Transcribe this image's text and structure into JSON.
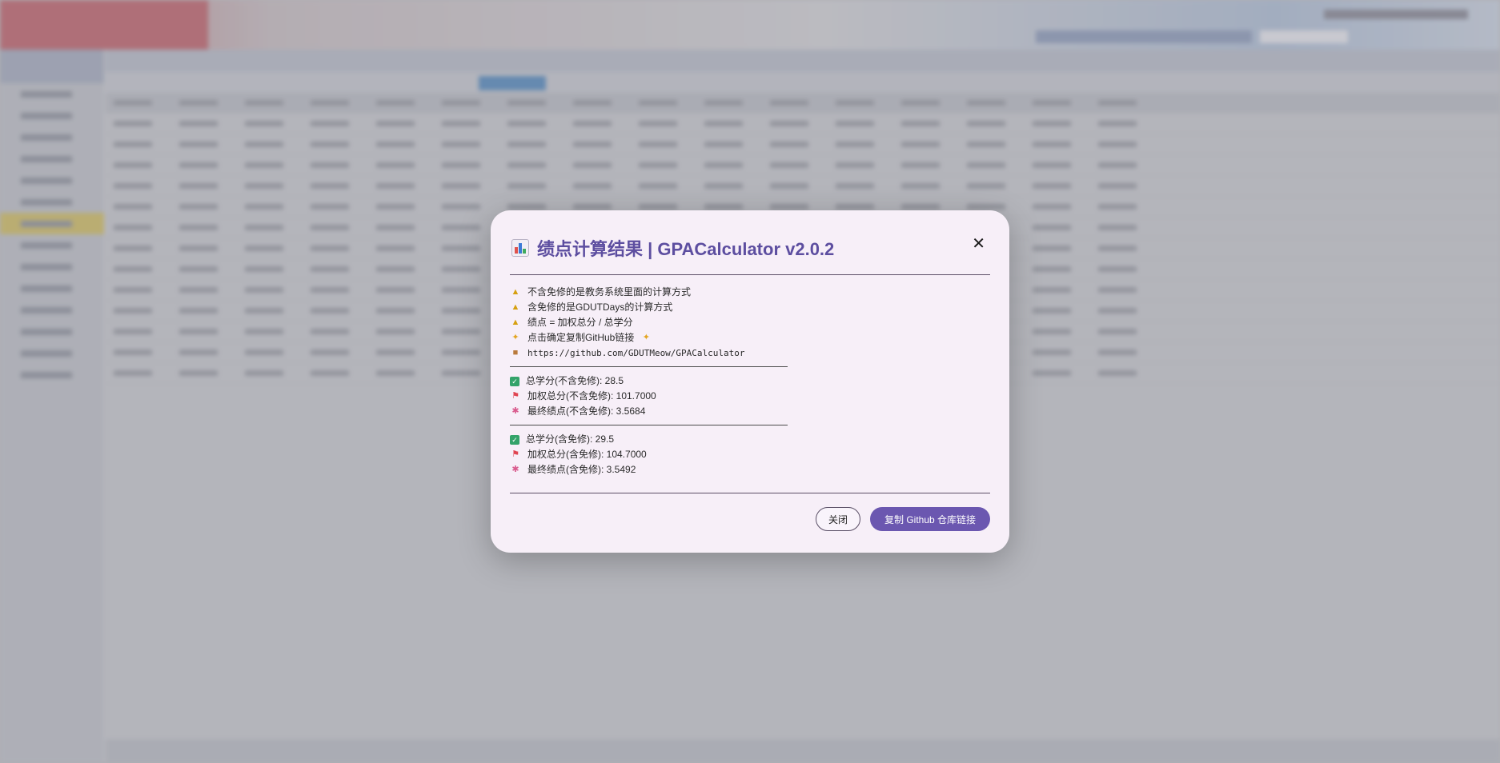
{
  "modal": {
    "title": "绩点计算结果 | GPACalculator v2.0.2",
    "close_symbol": "✕",
    "notes": [
      {
        "icon": "warning-icon",
        "text": "不含免修的是教务系统里面的计算方式"
      },
      {
        "icon": "warning-icon",
        "text": "含免修的是GDUTDays的计算方式"
      },
      {
        "icon": "warning-icon",
        "text": "绩点 = 加权总分 / 总学分"
      },
      {
        "icon": "sparkles-icon",
        "text": "点击确定复制GitHub链接"
      },
      {
        "icon": "package-icon",
        "text": "https://github.com/GDUTMeow/GPACalculator"
      }
    ],
    "without_exempt": {
      "credits": "总学分(不含免修): 28.5",
      "weighted": "加权总分(不含免修): 101.7000",
      "gpa": "最终绩点(不含免修): 3.5684"
    },
    "with_exempt": {
      "credits": "总学分(含免修): 29.5",
      "weighted": "加权总分(含免修): 104.7000",
      "gpa": "最终绩点(含免修): 3.5492"
    },
    "buttons": {
      "close_label": "关闭",
      "copy_label": "复制 Github 仓库链接"
    }
  },
  "colors": {
    "title": "#5d4ea0",
    "primary_button": "#6b57b0",
    "modal_bg": "#f7eff8"
  }
}
